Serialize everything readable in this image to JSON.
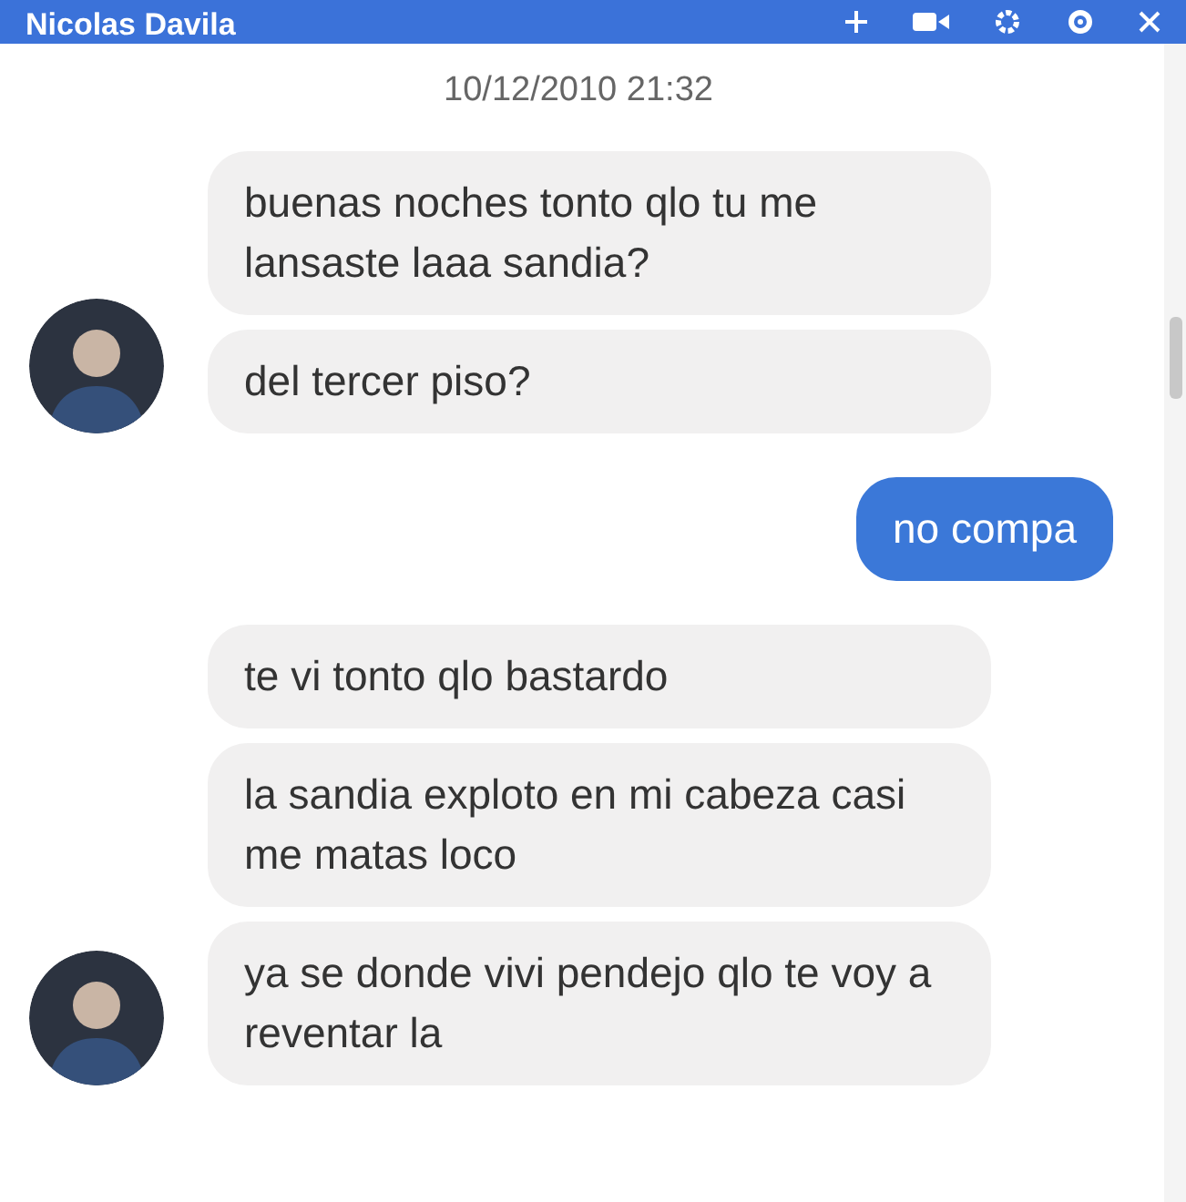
{
  "header": {
    "title": "Nicolas Davila"
  },
  "timestamp": "10/12/2010 21:32",
  "groups": [
    {
      "kind": "received",
      "messages": [
        "buenas noches tonto qlo tu me lansaste laaa sandia?",
        "del tercer piso?"
      ]
    },
    {
      "kind": "sent",
      "messages": [
        "no compa"
      ]
    },
    {
      "kind": "received",
      "messages": [
        "te vi tonto qlo bastardo",
        "la sandia exploto en mi cabeza casi me matas loco",
        "ya se donde vivi pendejo qlo te voy a reventar la"
      ]
    }
  ]
}
